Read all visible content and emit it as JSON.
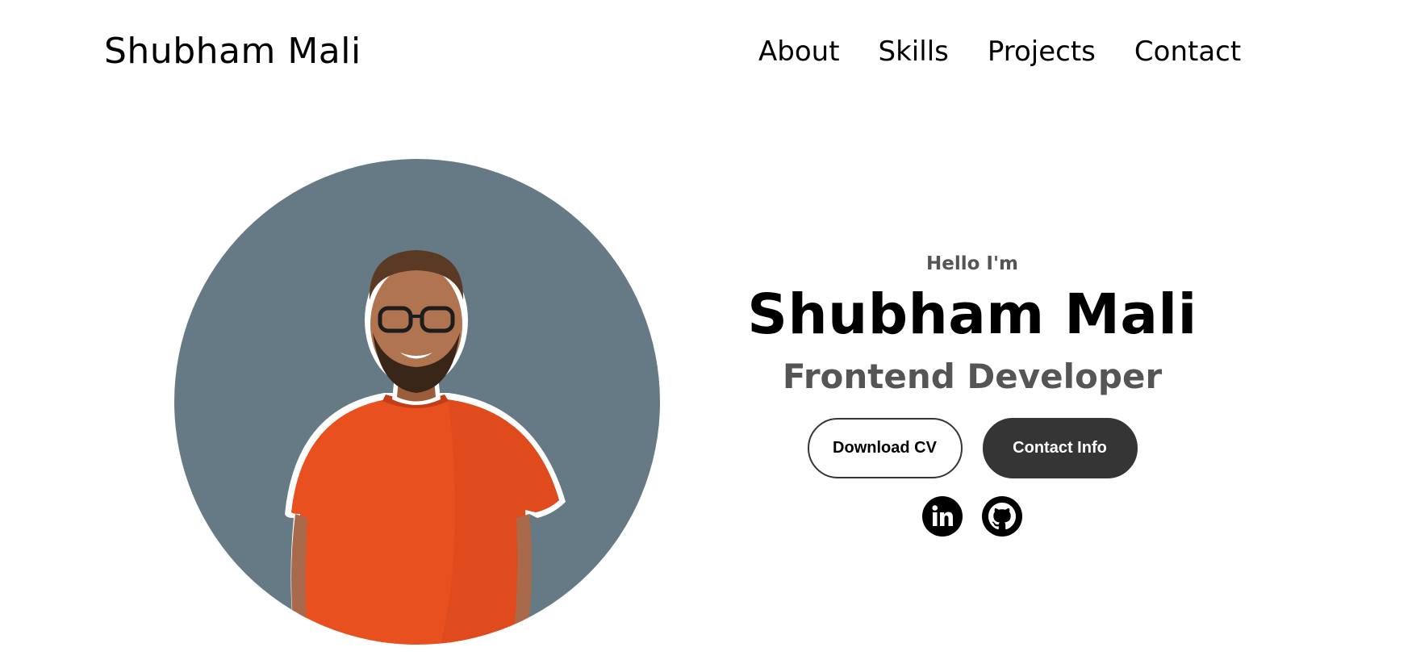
{
  "header": {
    "logo": "Shubham Mali",
    "nav": [
      {
        "label": "About"
      },
      {
        "label": "Skills"
      },
      {
        "label": "Projects"
      },
      {
        "label": "Contact"
      }
    ]
  },
  "hero": {
    "greeting": "Hello I'm",
    "name": "Shubham Mali",
    "role": "Frontend Developer",
    "buttons": {
      "download": "Download CV",
      "contact": "Contact Info"
    },
    "socials": [
      {
        "icon": "linkedin-icon"
      },
      {
        "icon": "github-icon"
      }
    ]
  },
  "colors": {
    "avatar_bg": "#667a86",
    "button_dark": "#353535",
    "muted_text": "#555555",
    "shirt": "#e8501f"
  }
}
